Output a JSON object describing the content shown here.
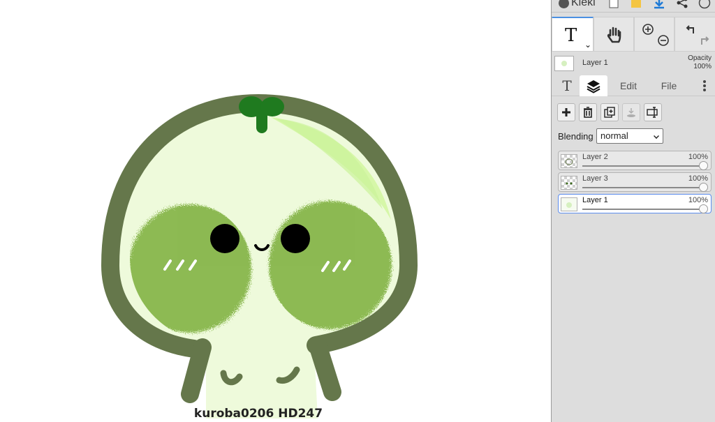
{
  "app": {
    "name": "Kleki"
  },
  "toolbar": {
    "active_tool": "text-tool",
    "accent_color": "#4a90e2"
  },
  "layer_preview": {
    "layer_name": "Layer 1",
    "opacity_label": "Opacity",
    "opacity_value": "100%"
  },
  "tabs": [
    {
      "label": "",
      "icon": "text-icon"
    },
    {
      "label": "",
      "icon": "layers-icon",
      "active": true
    },
    {
      "label": "Edit"
    },
    {
      "label": "File"
    }
  ],
  "layer_buttons": [
    {
      "icon": "plus-icon"
    },
    {
      "icon": "trash-icon"
    },
    {
      "icon": "duplicate-icon"
    },
    {
      "icon": "merge-down-icon",
      "disabled": true
    },
    {
      "icon": "rename-icon"
    }
  ],
  "blending": {
    "label": "Blending",
    "selected": "normal"
  },
  "layers": [
    {
      "name": "Layer 2",
      "opacity": "100%",
      "opacity_level": 1.0,
      "selected": false
    },
    {
      "name": "Layer 3",
      "opacity": "100%",
      "opacity_level": 1.0,
      "selected": false
    },
    {
      "name": "Layer 1",
      "opacity": "100%",
      "opacity_level": 1.0,
      "selected": true
    }
  ],
  "canvas": {
    "signature": "kuroba0206 HD247",
    "colors": {
      "outline": "#65774b",
      "body": "#eefadb",
      "highlight": "#d6f7a8",
      "blush": "#7cae3a",
      "sprout": "#1f7a1f",
      "eyes": "#000000"
    }
  }
}
